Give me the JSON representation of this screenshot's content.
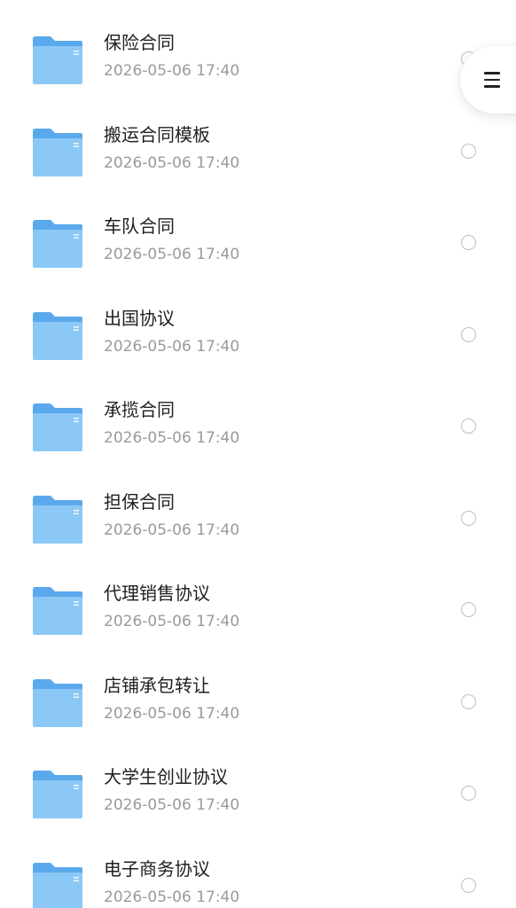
{
  "files": [
    {
      "name": "保险合同",
      "date": "2026-05-06 17:40"
    },
    {
      "name": "搬运合同模板",
      "date": "2026-05-06 17:40"
    },
    {
      "name": "车队合同",
      "date": "2026-05-06 17:40"
    },
    {
      "name": "出国协议",
      "date": "2026-05-06 17:40"
    },
    {
      "name": "承揽合同",
      "date": "2026-05-06 17:40"
    },
    {
      "name": "担保合同",
      "date": "2026-05-06 17:40"
    },
    {
      "name": "代理销售协议",
      "date": "2026-05-06 17:40"
    },
    {
      "name": "店铺承包转让",
      "date": "2026-05-06 17:40"
    },
    {
      "name": "大学生创业协议",
      "date": "2026-05-06 17:40"
    },
    {
      "name": "电子商务协议",
      "date": "2026-05-06 17:40"
    }
  ],
  "icons": {
    "folder": "folder-icon",
    "select": "radio-unchecked",
    "menu": "menu-icon"
  },
  "colors": {
    "folder_back": "#5aa9ec",
    "folder_front": "#8cc8f6"
  }
}
